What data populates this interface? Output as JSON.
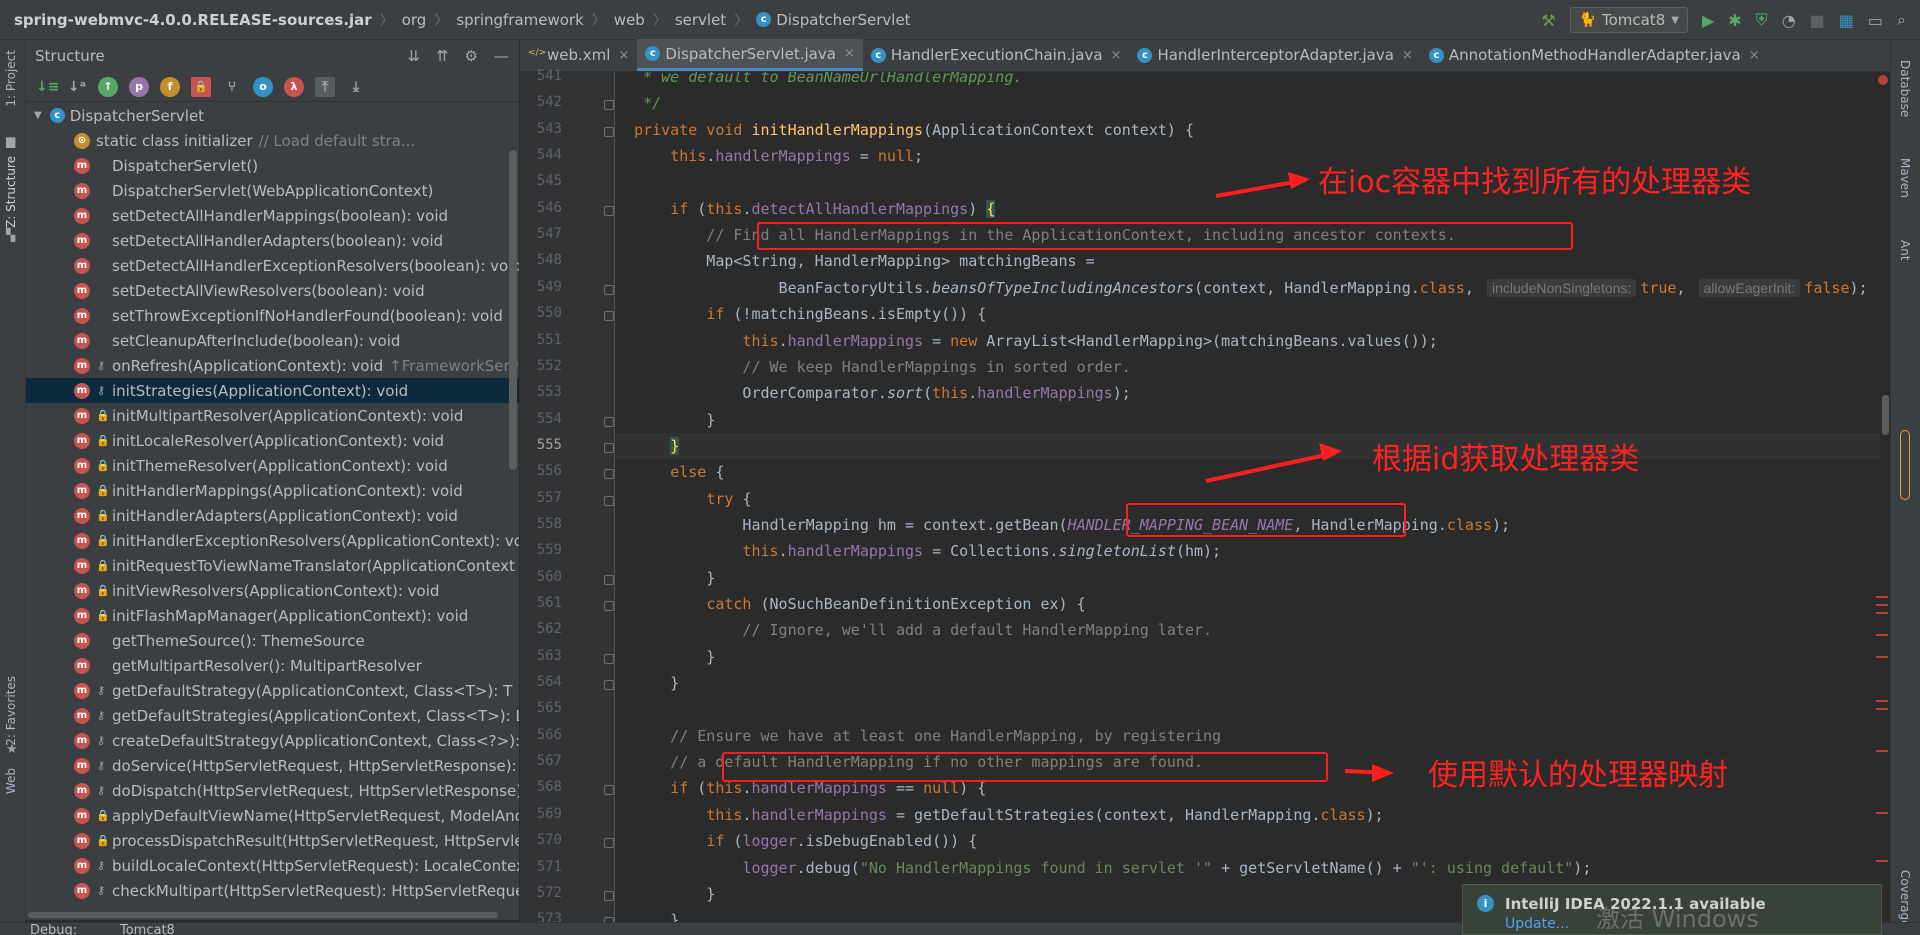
{
  "breadcrumbs": [
    {
      "label": "spring-webmvc-4.0.0.RELEASE-sources.jar",
      "bold": true
    },
    {
      "label": "org"
    },
    {
      "label": "springframework"
    },
    {
      "label": "web"
    },
    {
      "label": "servlet"
    },
    {
      "label": "DispatcherServlet",
      "icon": "class-icon"
    }
  ],
  "run_config": {
    "label": "Tomcat8"
  },
  "left_strip": {
    "project": "1: Project",
    "structure": "Z: Structure",
    "favorites": "2: Favorites",
    "web": "Web"
  },
  "right_strip": {
    "database": "Database",
    "maven": "Maven",
    "ant": "Ant",
    "coverage": "Coverage"
  },
  "structure": {
    "title": "Structure",
    "root": "DispatcherServlet",
    "items": [
      {
        "label": "static class initializer",
        "hint": "// Load default stra..."
      },
      {
        "label": "DispatcherServlet()",
        "vis": "public"
      },
      {
        "label": "DispatcherServlet(WebApplicationContext)",
        "vis": "public"
      },
      {
        "label": "setDetectAllHandlerMappings(boolean): void",
        "vis": "public"
      },
      {
        "label": "setDetectAllHandlerAdapters(boolean): void",
        "vis": "public"
      },
      {
        "label": "setDetectAllHandlerExceptionResolvers(boolean): void",
        "vis": "public"
      },
      {
        "label": "setDetectAllViewResolvers(boolean): void",
        "vis": "public"
      },
      {
        "label": "setThrowExceptionIfNoHandlerFound(boolean): void",
        "vis": "public"
      },
      {
        "label": "setCleanupAfterInclude(boolean): void",
        "vis": "public"
      },
      {
        "label": "onRefresh(ApplicationContext): void",
        "vis": "protected",
        "hint": "↑FrameworkServle"
      },
      {
        "label": "initStrategies(ApplicationContext): void",
        "vis": "protected",
        "selected": true
      },
      {
        "label": "initMultipartResolver(ApplicationContext): void",
        "vis": "private"
      },
      {
        "label": "initLocaleResolver(ApplicationContext): void",
        "vis": "private"
      },
      {
        "label": "initThemeResolver(ApplicationContext): void",
        "vis": "private"
      },
      {
        "label": "initHandlerMappings(ApplicationContext): void",
        "vis": "private"
      },
      {
        "label": "initHandlerAdapters(ApplicationContext): void",
        "vis": "private"
      },
      {
        "label": "initHandlerExceptionResolvers(ApplicationContext): vo",
        "vis": "private"
      },
      {
        "label": "initRequestToViewNameTranslator(ApplicationContext",
        "vis": "private"
      },
      {
        "label": "initViewResolvers(ApplicationContext): void",
        "vis": "private"
      },
      {
        "label": "initFlashMapManager(ApplicationContext): void",
        "vis": "private"
      },
      {
        "label": "getThemeSource(): ThemeSource",
        "vis": "public"
      },
      {
        "label": "getMultipartResolver(): MultipartResolver",
        "vis": "public"
      },
      {
        "label": "getDefaultStrategy(ApplicationContext, Class<T>): T",
        "vis": "protected"
      },
      {
        "label": "getDefaultStrategies(ApplicationContext, Class<T>): Lis",
        "vis": "protected"
      },
      {
        "label": "createDefaultStrategy(ApplicationContext, Class<?>): O",
        "vis": "protected"
      },
      {
        "label": "doService(HttpServletRequest, HttpServletResponse):",
        "vis": "protected"
      },
      {
        "label": "doDispatch(HttpServletRequest, HttpServletResponse)",
        "vis": "protected"
      },
      {
        "label": "applyDefaultViewName(HttpServletRequest, ModelAnd",
        "vis": "private"
      },
      {
        "label": "processDispatchResult(HttpServletRequest, HttpServle",
        "vis": "private"
      },
      {
        "label": "buildLocaleContext(HttpServletRequest): LocaleContex",
        "vis": "protected"
      },
      {
        "label": "checkMultipart(HttpServletRequest): HttpServletReque",
        "vis": "protected"
      }
    ]
  },
  "tabs": [
    {
      "label": "web.xml",
      "type": "xml",
      "active": false
    },
    {
      "label": "DispatcherServlet.java",
      "type": "class",
      "active": true
    },
    {
      "label": "HandlerExecutionChain.java",
      "type": "class",
      "active": false
    },
    {
      "label": "HandlerInterceptorAdapter.java",
      "type": "class",
      "active": false
    },
    {
      "label": "AnnotationMethodHandlerAdapter.java",
      "type": "class",
      "active": false
    }
  ],
  "editor": {
    "current_line": "555",
    "lines": [
      {
        "n": "541",
        "html": "<span class=\"doc\">   * we default to BeanNameUrlHandlerMapping.</span>"
      },
      {
        "n": "542",
        "html": "<span class=\"doc\">   */</span>"
      },
      {
        "n": "543",
        "html": "  <span class=\"kw\">private void </span><span class=\"mtd\">initHandlerMappings</span>(ApplicationContext context) {"
      },
      {
        "n": "544",
        "html": "      <span class=\"kw\">this</span>.<span class=\"fld\">handlerMappings</span> = <span class=\"kw\">null</span>;"
      },
      {
        "n": "545",
        "html": ""
      },
      {
        "n": "546",
        "html": "      <span class=\"kw\">if </span>(<span class=\"kw\">this</span>.<span class=\"fld\">detectAllHandlerMappings</span>) <span style=\"color:#ffef28;background:#3b514d\">{</span>"
      },
      {
        "n": "547",
        "html": "<span class=\"cm\">          // Find all HandlerMappings in the ApplicationContext, including ancestor contexts.</span>"
      },
      {
        "n": "548",
        "html": "          Map&lt;String, HandlerMapping&gt; matchingBeans ="
      },
      {
        "n": "549",
        "html": "                  BeanFactoryUtils.<span class=\"it\">beansOfTypeIncludingAncestors</span>(context, HandlerMapping.<span class=\"kw\">class</span>, <span class=\"inlay\">includeNonSingletons:</span><span class=\"kw\">true</span>, <span class=\"inlay\">allowEagerInit:</span><span class=\"kw\">false</span>);"
      },
      {
        "n": "550",
        "html": "          <span class=\"kw\">if </span>(!matchingBeans.isEmpty()) {"
      },
      {
        "n": "551",
        "html": "              <span class=\"kw\">this</span>.<span class=\"fld\">handlerMappings</span> = <span class=\"kw\">new </span>ArrayList&lt;HandlerMapping&gt;(matchingBeans.values());"
      },
      {
        "n": "552",
        "html": "<span class=\"cm\">              // We keep HandlerMappings in sorted order.</span>"
      },
      {
        "n": "553",
        "html": "              OrderComparator.<span class=\"it\">sort</span>(<span class=\"kw\">this</span>.<span class=\"fld\">handlerMappings</span>);"
      },
      {
        "n": "554",
        "html": "          }"
      },
      {
        "n": "555",
        "html": "      <span style=\"color:#ffef28;background:#3b514d\">}</span>"
      },
      {
        "n": "556",
        "html": "      <span class=\"kw\">else </span>{"
      },
      {
        "n": "557",
        "html": "          <span class=\"kw\">try </span>{"
      },
      {
        "n": "558",
        "html": "              HandlerMapping hm = context.getBean(<span class=\"const\">HANDLER_MAPPING_BEAN_NAME</span>, HandlerMapping.<span class=\"kw\">class</span>);"
      },
      {
        "n": "559",
        "html": "              <span class=\"kw\">this</span>.<span class=\"fld\">handlerMappings</span> = Collections.<span class=\"it\">singletonList</span>(hm);"
      },
      {
        "n": "560",
        "html": "          }"
      },
      {
        "n": "561",
        "html": "          <span class=\"kw\">catch </span>(NoSuchBeanDefinitionException ex) {"
      },
      {
        "n": "562",
        "html": "<span class=\"cm\">              // Ignore, we'll add a default HandlerMapping later.</span>"
      },
      {
        "n": "563",
        "html": "          }"
      },
      {
        "n": "564",
        "html": "      }"
      },
      {
        "n": "565",
        "html": ""
      },
      {
        "n": "566",
        "html": "<span class=\"cm\">      // Ensure we have at least one HandlerMapping, by registering</span>"
      },
      {
        "n": "567",
        "html": "<span class=\"cm\">      // a default HandlerMapping if no other mappings are found.</span>"
      },
      {
        "n": "568",
        "html": "      <span class=\"kw\">if </span>(<span class=\"kw\">this</span>.<span class=\"fld\">handlerMappings</span> == <span class=\"kw\">null</span>) {"
      },
      {
        "n": "569",
        "html": "          <span class=\"kw\">this</span>.<span class=\"fld\">handlerMappings</span> = getDefaultStrategies(context, HandlerMapping.<span class=\"kw\">class</span>);"
      },
      {
        "n": "570",
        "html": "          <span class=\"kw\">if </span>(<span class=\"fld\">logger</span>.isDebugEnabled()) {"
      },
      {
        "n": "571",
        "html": "              <span class=\"fld\">logger</span>.debug(<span class=\"str\">\"No HandlerMappings found in servlet '\"</span> + getServletName() + <span class=\"str\">\"': using default\"</span>);"
      },
      {
        "n": "572",
        "html": "          }"
      },
      {
        "n": "573",
        "html": "      }"
      }
    ]
  },
  "annotations": {
    "find_all": "在ioc容器中找到所有的处理器类",
    "by_id": "根据id获取处理器类",
    "default": "使用默认的处理器映射"
  },
  "notification": {
    "title": "IntelliJ IDEA 2022.1.1 available",
    "link": "Update..."
  },
  "watermark": "激活 Windows",
  "bottom": {
    "debug": "Debug:",
    "tomcat": "Tomcat8"
  },
  "colors": {
    "accent": "#4a88c7",
    "method_icon": "#c75450",
    "class_icon": "#3592c4",
    "annotation_red": "#ff1e1e"
  }
}
